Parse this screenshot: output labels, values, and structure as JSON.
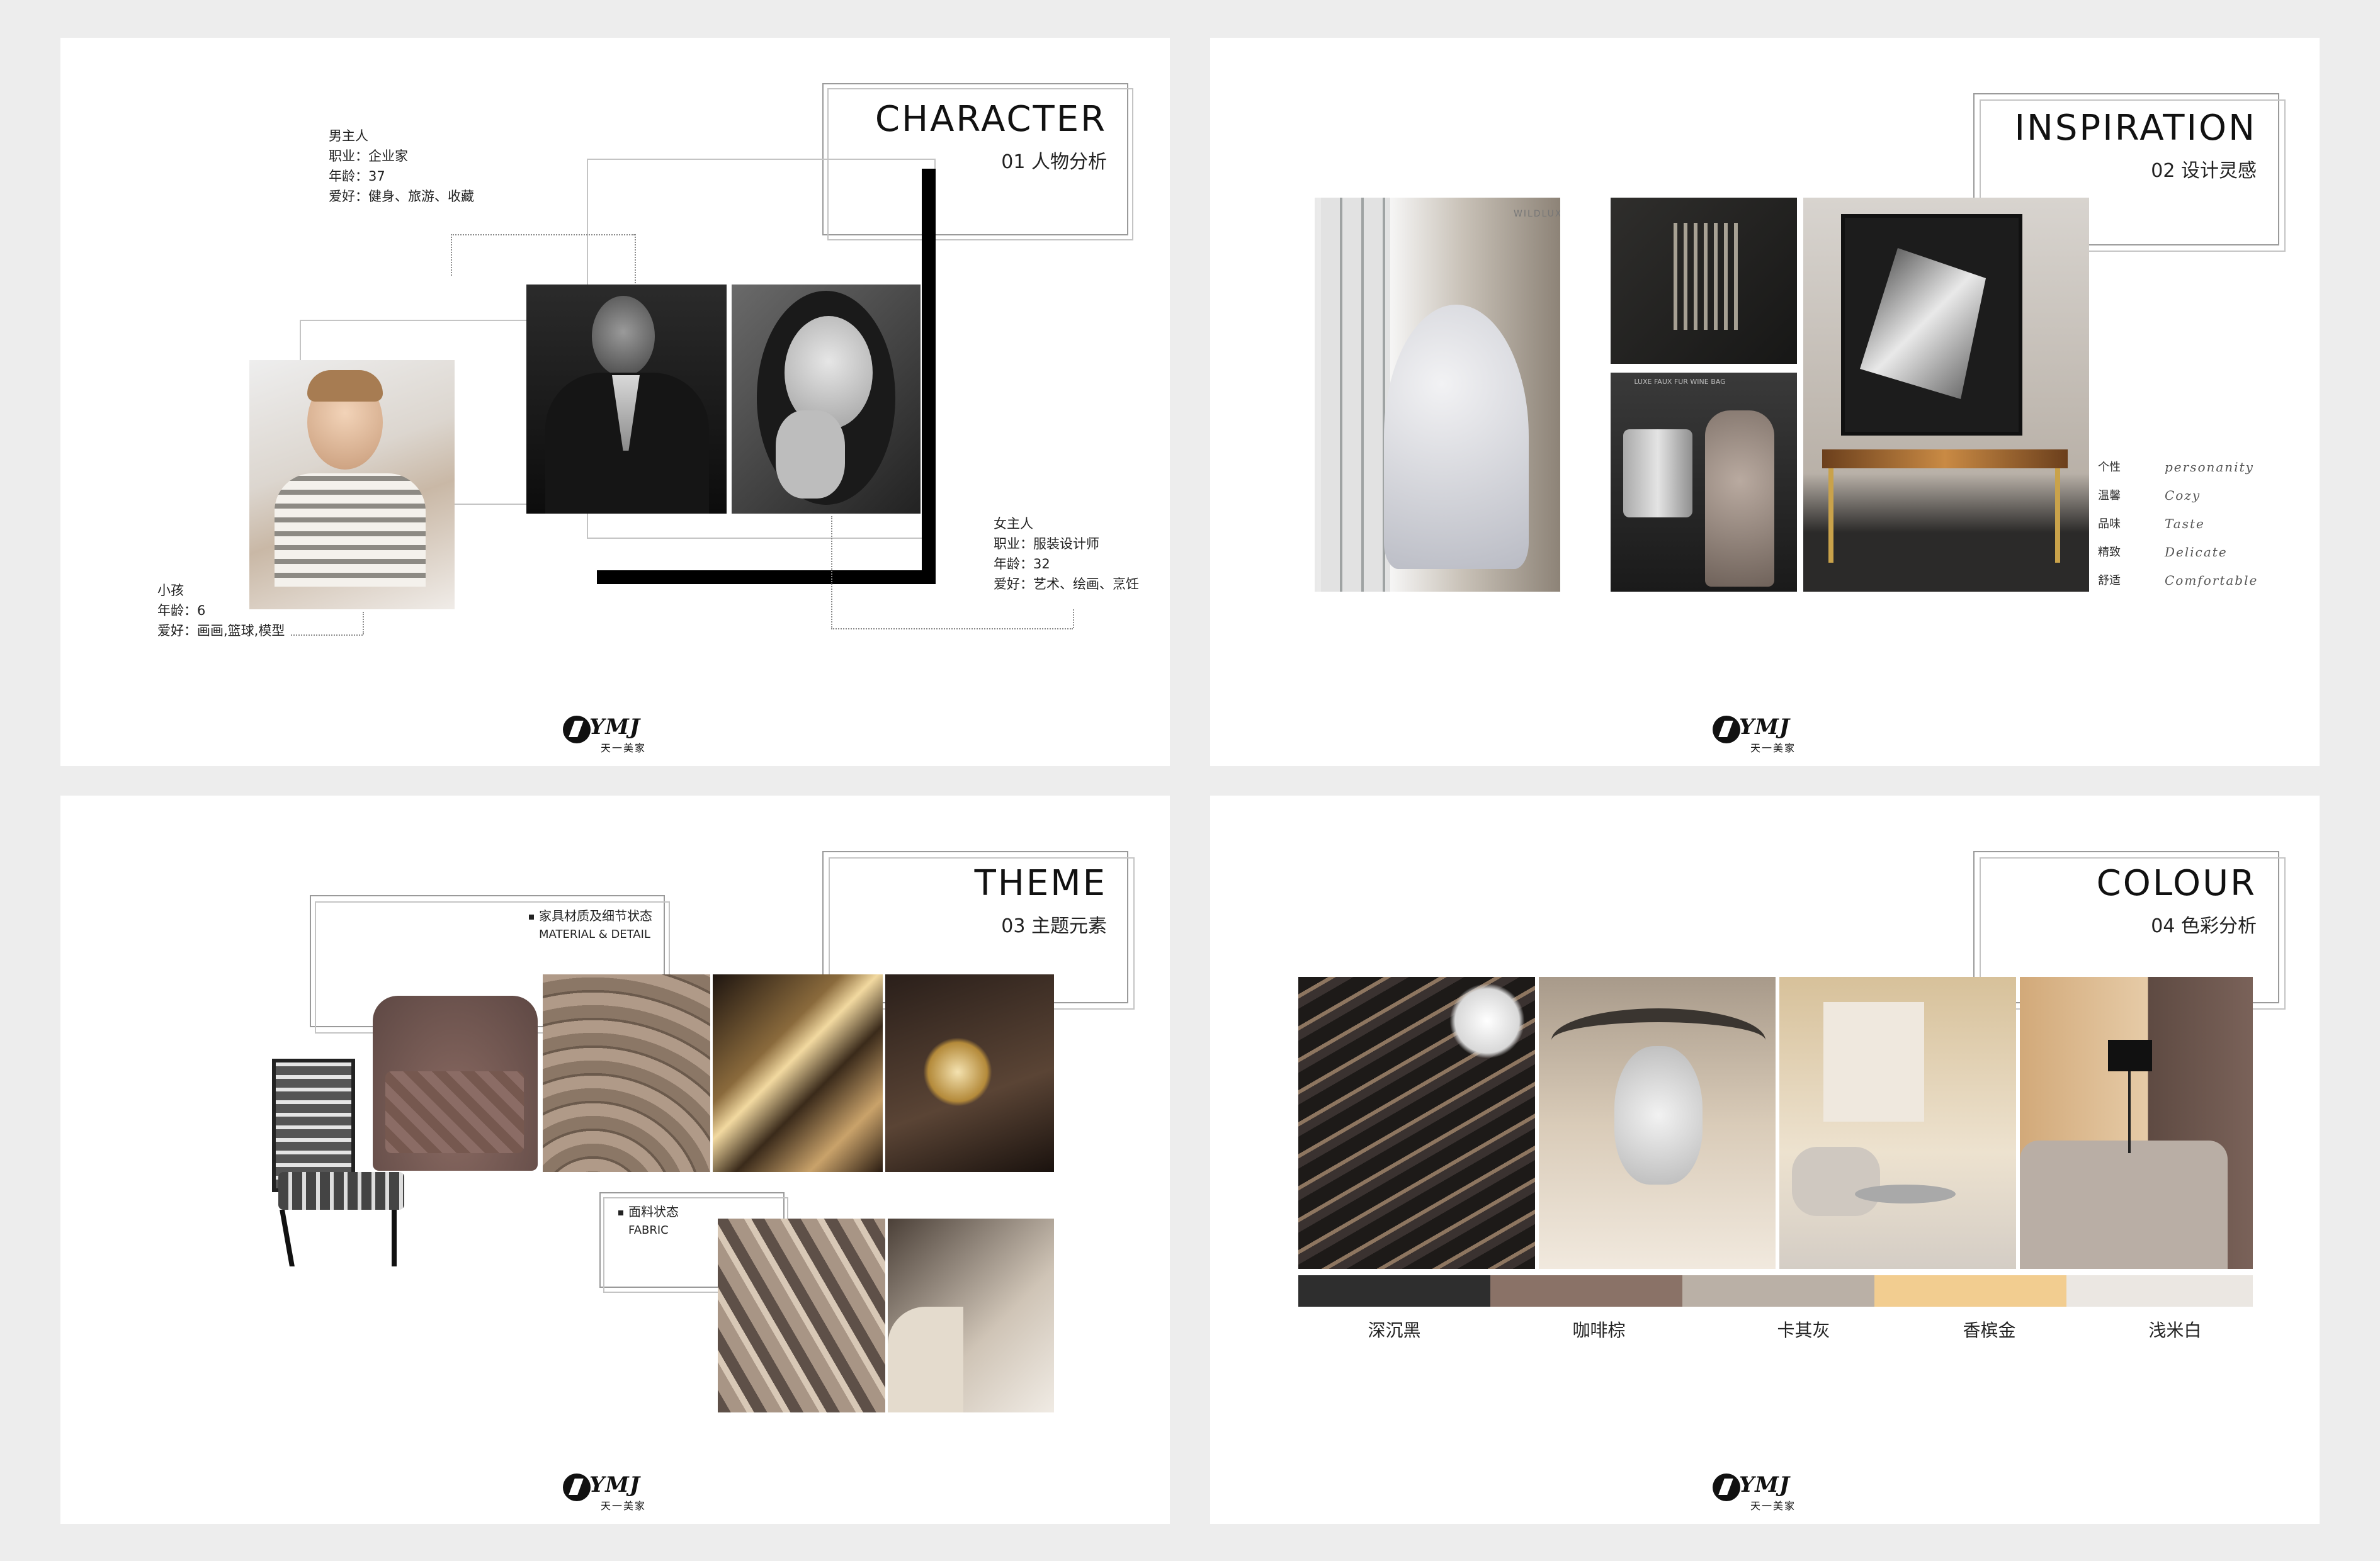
{
  "pages": {
    "character": {
      "title_en": "CHARACTER",
      "title_cn": "01 人物分析",
      "man": {
        "role": "男主人",
        "job": "职业：企业家",
        "age": "年龄：37",
        "hobby": "爱好：健身、旅游、收藏"
      },
      "woman": {
        "role": "女主人",
        "job": "职业：服装设计师",
        "age": "年龄：32",
        "hobby": "爱好：艺术、绘画、烹饪"
      },
      "child": {
        "role": "小孩",
        "age": "年龄：6",
        "hobby": "爱好：画画,篮球,模型"
      }
    },
    "inspiration": {
      "title_en": "INSPIRATION",
      "title_cn": "02 设计灵感",
      "keywords": [
        {
          "cn": "个性",
          "en": "personanity"
        },
        {
          "cn": "温馨",
          "en": "Cozy"
        },
        {
          "cn": "品味",
          "en": "Taste"
        },
        {
          "cn": "精致",
          "en": "Delicate"
        },
        {
          "cn": "舒适",
          "en": "Comfortable"
        }
      ],
      "magazine_text": "WILDLUXE",
      "bag_text": "LUXE FAUX FUR WINE BAG"
    },
    "theme": {
      "title_en": "THEME",
      "title_cn": "03 主题元素",
      "material_cn": "家具材质及细节状态",
      "material_en": "MATERIAL & DETAIL",
      "fabric_cn": "面料状态",
      "fabric_en": "FABRIC"
    },
    "colour": {
      "title_en": "COLOUR",
      "title_cn": "04 色彩分析",
      "swatches": [
        {
          "name": "深沉黑",
          "color": "#2e2e2e"
        },
        {
          "name": "咖啡棕",
          "color": "#8a7267"
        },
        {
          "name": "卡其灰",
          "color": "#bab0a6"
        },
        {
          "name": "香槟金",
          "color": "#f2cd90"
        },
        {
          "name": "浅米白",
          "color": "#ebe7e2"
        }
      ]
    }
  },
  "logo": {
    "word": "YMJ",
    "sub": "天一美家"
  }
}
